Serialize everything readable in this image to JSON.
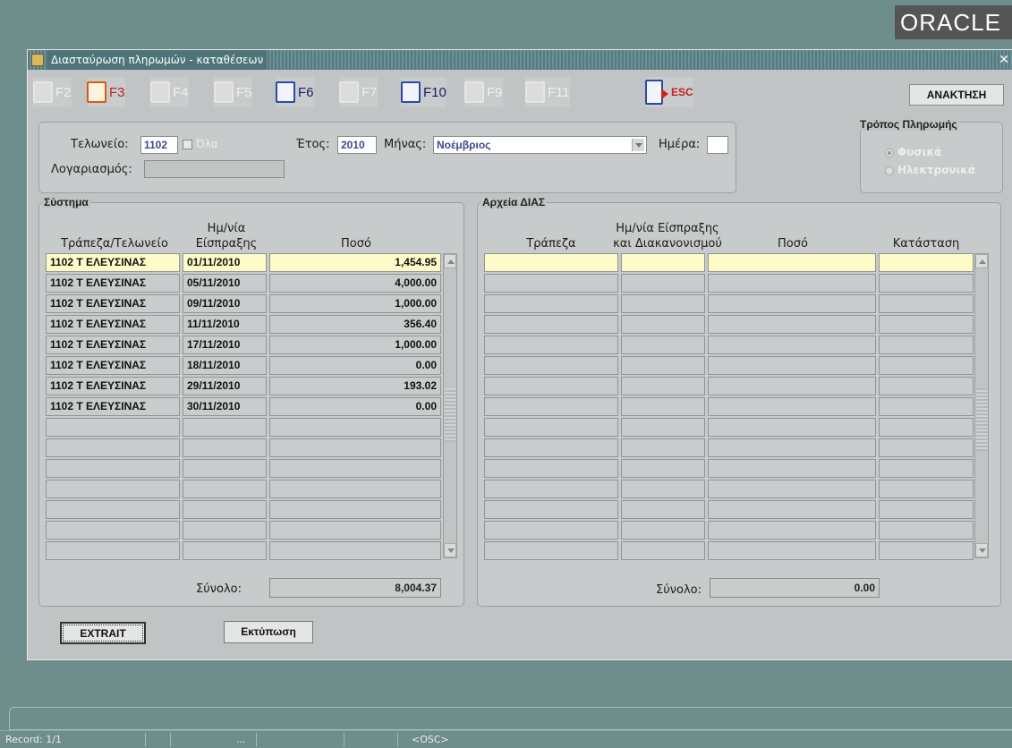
{
  "brand": {
    "logo_text": "ORACLE"
  },
  "window": {
    "title": "Διασταύρωση πληρωμών - καταθέσεων",
    "close_symbol": "✕"
  },
  "toolbar": {
    "buttons": [
      {
        "key": "F2",
        "icon": "save-icon",
        "enabled": false
      },
      {
        "key": "F3",
        "icon": "query-icon",
        "enabled": true
      },
      {
        "key": "F4",
        "icon": "insert-icon",
        "enabled": false
      },
      {
        "key": "F5",
        "icon": "delete-icon",
        "enabled": false
      },
      {
        "key": "F6",
        "icon": "new-document-icon",
        "enabled": true
      },
      {
        "key": "F7",
        "icon": "zoom-icon",
        "enabled": false
      },
      {
        "key": "F10",
        "icon": "print-icon",
        "enabled": true
      },
      {
        "key": "F9",
        "icon": "list-icon",
        "enabled": false
      },
      {
        "key": "F11",
        "icon": "clear-icon",
        "enabled": false
      },
      {
        "key": "ESC",
        "icon": "exit-door-icon",
        "enabled": true
      }
    ],
    "retrieve_label": "ΑΝΑΚΤΗΣΗ"
  },
  "filters": {
    "customs_label": "Τελωνείο:",
    "customs_value": "1102",
    "all_label": "Όλα",
    "year_label": "Έτος:",
    "year_value": "2010",
    "month_label": "Μήνας:",
    "month_value": "Νοέμβριος",
    "day_label": "Ημέρα:",
    "day_value": "",
    "account_label": "Λογαριασμός:",
    "account_value": ""
  },
  "payment_method": {
    "title": "Τρόπος Πληρωμής",
    "options": [
      {
        "label": "Φυσικά",
        "selected": true
      },
      {
        "label": "Ηλεκτρονικά",
        "selected": false
      }
    ]
  },
  "system_panel": {
    "title": "Σύστημα",
    "col_bank": "Τράπεζα/Τελωνείο",
    "col_date_line1": "Ημ/νία",
    "col_date_line2": "Είσπραξης",
    "col_amount": "Ποσό",
    "rows": [
      {
        "bank": "1102 Τ ΕΛΕΥΣΙΝΑΣ",
        "date": "01/11/2010",
        "amount": "1,454.95"
      },
      {
        "bank": "1102 Τ ΕΛΕΥΣΙΝΑΣ",
        "date": "05/11/2010",
        "amount": "4,000.00"
      },
      {
        "bank": "1102 Τ ΕΛΕΥΣΙΝΑΣ",
        "date": "09/11/2010",
        "amount": "1,000.00"
      },
      {
        "bank": "1102 Τ ΕΛΕΥΣΙΝΑΣ",
        "date": "11/11/2010",
        "amount": "356.40"
      },
      {
        "bank": "1102 Τ ΕΛΕΥΣΙΝΑΣ",
        "date": "17/11/2010",
        "amount": "1,000.00"
      },
      {
        "bank": "1102 Τ ΕΛΕΥΣΙΝΑΣ",
        "date": "18/11/2010",
        "amount": "0.00"
      },
      {
        "bank": "1102 Τ ΕΛΕΥΣΙΝΑΣ",
        "date": "29/11/2010",
        "amount": "193.02"
      },
      {
        "bank": "1102 Τ ΕΛΕΥΣΙΝΑΣ",
        "date": "30/11/2010",
        "amount": "0.00"
      }
    ],
    "total_label": "Σύνολο:",
    "total_value": "8,004.37"
  },
  "dias_panel": {
    "title": "Αρχεία ΔΙΑΣ",
    "col_bank": "Τράπεζα",
    "col_date_line1": "Ημ/νία Είσπραξης",
    "col_date_line2": "και Διακανονισμού",
    "col_amount": "Ποσό",
    "col_status": "Κατάσταση",
    "total_label": "Σύνολο:",
    "total_value": "0.00"
  },
  "actions": {
    "extrait_label": "EXTRAIT",
    "print_label": "Εκτύπωση"
  },
  "statusbar": {
    "record": "Record: 1/1",
    "dots": "...",
    "osc": "<OSC>"
  }
}
